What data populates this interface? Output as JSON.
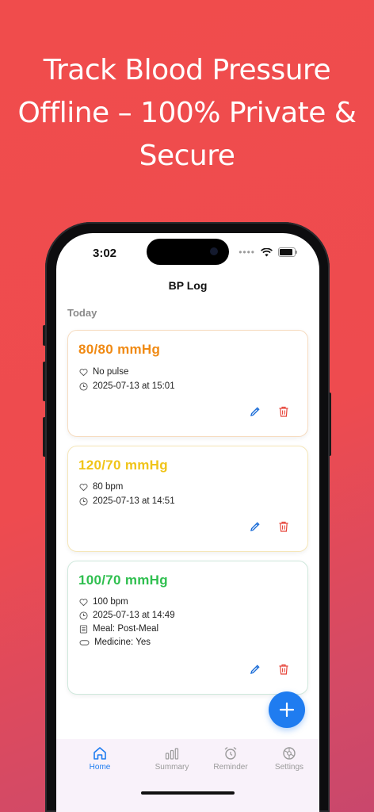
{
  "headline": {
    "line1": "Track Blood Pressure",
    "line2": "Offline – 100% Private &",
    "line3": "Secure"
  },
  "status_bar": {
    "time": "3:02"
  },
  "nav": {
    "title": "BP Log"
  },
  "section": {
    "label": "Today"
  },
  "readings": [
    {
      "bp": "80/80 mmHg",
      "color": "#f08a14",
      "border": "#f6dcc0",
      "pulse": "No pulse",
      "datetime": "2025-07-13 at 15:01"
    },
    {
      "bp": "120/70 mmHg",
      "color": "#f0c419",
      "border": "#f5e6b8",
      "pulse": "80 bpm",
      "datetime": "2025-07-13 at 14:51"
    },
    {
      "bp": "100/70 mmHg",
      "color": "#2fbf4f",
      "border": "#cfe8dc",
      "pulse": "100 bpm",
      "datetime": "2025-07-13 at 14:49",
      "meal": "Meal: Post-Meal",
      "medicine": "Medicine: Yes"
    }
  ],
  "colors": {
    "accent": "#1f7cf0",
    "delete": "#e6453a",
    "edit": "#1f6fd8",
    "inactive_tab": "#9a9a9a"
  },
  "tabs": [
    {
      "label": "Home",
      "icon": "home-icon",
      "active": true
    },
    {
      "label": "Summary",
      "icon": "bar-chart-icon",
      "active": false
    },
    {
      "label": "Reminder",
      "icon": "alarm-clock-icon",
      "active": false
    },
    {
      "label": "Settings",
      "icon": "gear-icon",
      "active": false
    }
  ]
}
